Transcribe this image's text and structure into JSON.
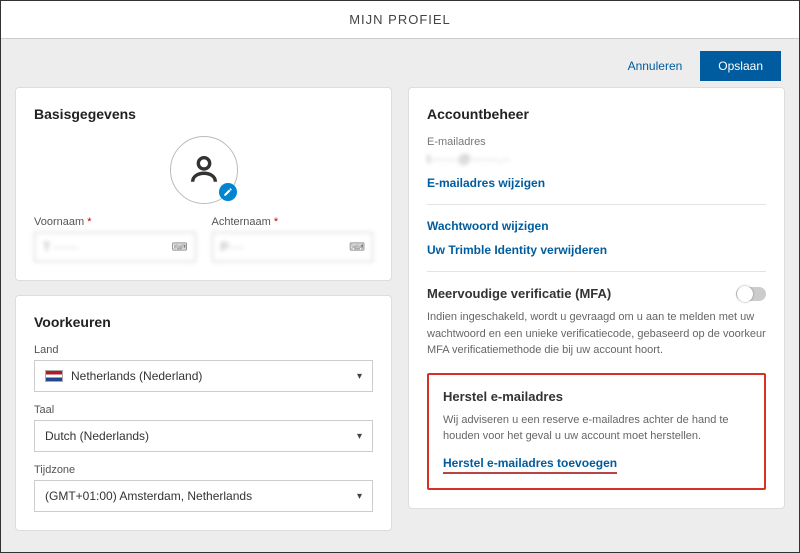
{
  "header": {
    "title": "MIJN PROFIEL"
  },
  "actions": {
    "cancel": "Annuleren",
    "save": "Opslaan"
  },
  "basics": {
    "heading": "Basisgegevens",
    "firstname_label": "Voornaam",
    "lastname_label": "Achternaam",
    "firstname_value": "T ······",
    "lastname_value": "P····"
  },
  "prefs": {
    "heading": "Voorkeuren",
    "country_label": "Land",
    "country_value": "Netherlands (Nederland)",
    "language_label": "Taal",
    "language_value": "Dutch (Nederlands)",
    "timezone_label": "Tijdzone",
    "timezone_value": "(GMT+01:00) Amsterdam, Netherlands"
  },
  "account": {
    "heading": "Accountbeheer",
    "email_label": "E-mailadres",
    "email_value": "t·······@·······.··",
    "change_email": "E-mailadres wijzigen",
    "change_password": "Wachtwoord wijzigen",
    "delete_identity": "Uw Trimble Identity verwijderen"
  },
  "mfa": {
    "title": "Meervoudige verificatie (MFA)",
    "desc": "Indien ingeschakeld, wordt u gevraagd om u aan te melden met uw wachtwoord en een unieke verificatiecode, gebaseerd op de voorkeur MFA verificatiemethode die bij uw account hoort."
  },
  "recovery": {
    "title": "Herstel e-mailadres",
    "desc": "Wij adviseren u een reserve e-mailadres achter de hand te houden voor het geval u uw account moet herstellen.",
    "link": "Herstel e-mailadres toevoegen"
  }
}
